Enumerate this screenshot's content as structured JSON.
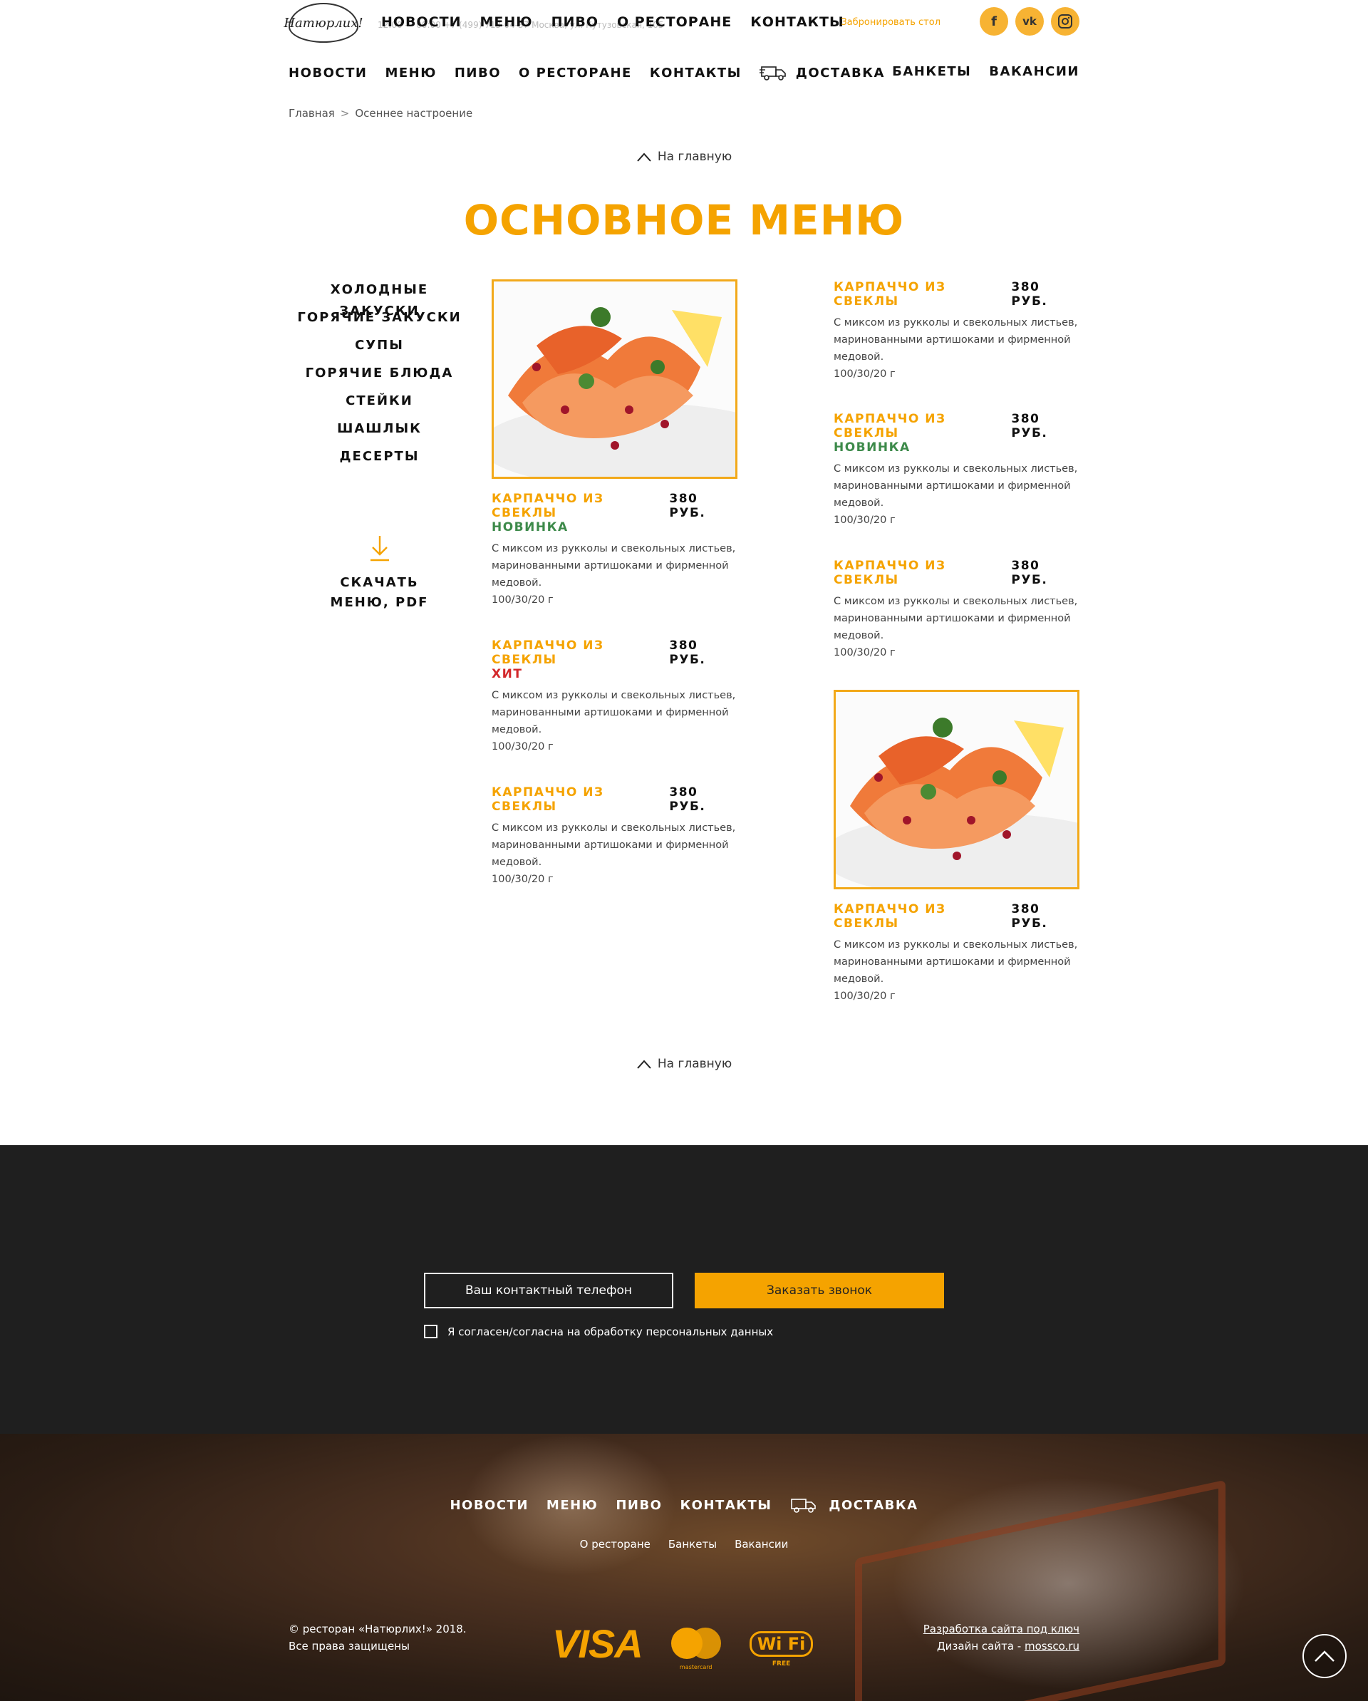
{
  "header": {
    "logo_text": "Натюрлих!",
    "top_nav": [
      "НОВОСТИ",
      "МЕНЮ",
      "ПИВО",
      "О РЕСТОРАНЕ",
      "КОНТАКТЫ"
    ],
    "top_info": "12:00 — 00:00       +7 (499) 713-04-37       Москва, ул. Кутузовская, 105",
    "reserve": "Забронировать стол",
    "socials": [
      "f",
      "vk",
      "ig"
    ]
  },
  "nav": {
    "left": [
      "НОВОСТИ",
      "МЕНЮ",
      "ПИВО",
      "О РЕСТОРАНЕ",
      "КОНТАКТЫ",
      "ДОСТАВКА"
    ],
    "right": [
      "БАНКЕТЫ",
      "ВАКАНСИИ"
    ]
  },
  "breadcrumb": {
    "home": "Главная",
    "sep": ">",
    "current": "Осеннее настроение"
  },
  "to_home": "На главную",
  "title": "ОСНОВНОЕ МЕНЮ",
  "categories": [
    "ХОЛОДНЫЕ ЗАКУСКИ",
    "ГОРЯЧИЕ ЗАКУСКИ",
    "СУПЫ",
    "ГОРЯЧИЕ БЛЮДА",
    "СТЕЙКИ",
    "ШАШЛЫК",
    "ДЕСЕРТЫ"
  ],
  "download": {
    "line1": "СКАЧАТЬ",
    "line2": "МЕНЮ, PDF"
  },
  "dishes": [
    {
      "name": "КАРПАЧЧО ИЗ СВЕКЛЫ",
      "price": "380 РУБ.",
      "badge": "НОВИНКА",
      "desc": "С миксом из рукколы и свекольных листьев, маринованными артишоками и фирменной медовой.",
      "weight": "100/30/20 г"
    },
    {
      "name": "КАРПАЧЧО ИЗ СВЕКЛЫ",
      "price": "380 РУБ.",
      "badge": "ХИТ",
      "desc": "С миксом из рукколы и свекольных листьев, маринованными артишоками и фирменной медовой.",
      "weight": "100/30/20 г"
    },
    {
      "name": "КАРПАЧЧО ИЗ СВЕКЛЫ",
      "price": "380 РУБ.",
      "badge": "",
      "desc": "С миксом из рукколы и свекольных листьев, маринованными артишоками и фирменной медовой.",
      "weight": "100/30/20 г"
    },
    {
      "name": "КАРПАЧЧО ИЗ СВЕКЛЫ",
      "price": "380 РУБ.",
      "badge": "",
      "desc": "С миксом из рукколы и свекольных листьев, маринованными артишоками и фирменной медовой.",
      "weight": "100/30/20 г"
    },
    {
      "name": "КАРПАЧЧО ИЗ СВЕКЛЫ",
      "price": "380 РУБ.",
      "badge": "НОВИНКА",
      "desc": "С миксом из рукколы и свекольных листьев, маринованными артишоками и фирменной медовой.",
      "weight": "100/30/20 г"
    },
    {
      "name": "КАРПАЧЧО ИЗ СВЕКЛЫ",
      "price": "380 РУБ.",
      "badge": "",
      "desc": "С миксом из рукколы и свекольных листьев, маринованными артишоками и фирменной медовой.",
      "weight": "100/30/20 г"
    },
    {
      "name": "КАРПАЧЧО ИЗ СВЕКЛЫ",
      "price": "380 РУБ.",
      "badge": "",
      "desc": "С миксом из рукколы и свекольных листьев, маринованными артишоками и фирменной медовой.",
      "weight": "100/30/20 г"
    }
  ],
  "callback": {
    "phone_placeholder": "Ваш контактный телефон",
    "button": "Заказать звонок",
    "consent": "Я согласен/согласна на обработку персональных данных"
  },
  "footer": {
    "nav": [
      "НОВОСТИ",
      "МЕНЮ",
      "ПИВО",
      "КОНТАКТЫ",
      "ДОСТАВКА"
    ],
    "sub": [
      "О ресторане",
      "Банкеты",
      "Вакансии"
    ],
    "copy1": "© ресторан «Натюрлих!» 2018.",
    "copy2": "Все права защищены",
    "visa": "VISA",
    "mastercard": "mastercard",
    "wifi": "Wi Fi",
    "wifi_free": "FREE",
    "dev": "Разработка сайта под ключ",
    "design_prefix": "Дизайн сайта - ",
    "design_link": "mossco.ru"
  },
  "colors": {
    "accent": "#f5a300",
    "new": "#3d8a4a",
    "hit": "#d3282b",
    "dark": "#1f1f1f"
  }
}
